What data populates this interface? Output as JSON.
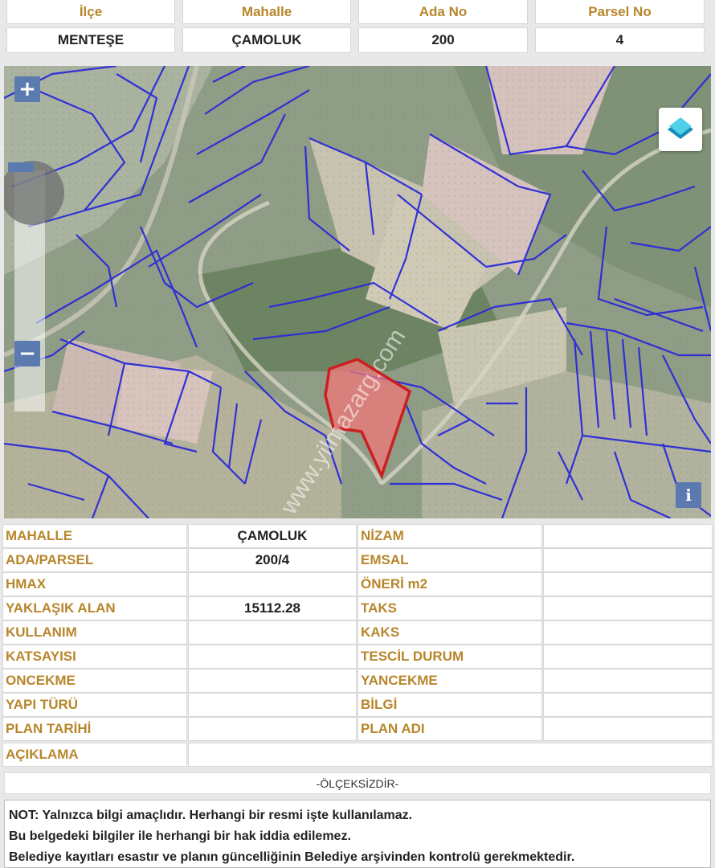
{
  "header": {
    "labels": [
      "İlçe",
      "Mahalle",
      "Ada No",
      "Parsel No"
    ],
    "values": [
      "MENTEŞE",
      "ÇAMOLUK",
      "200",
      "4"
    ]
  },
  "map": {
    "zoom_in_label": "+",
    "zoom_out_label": "−",
    "info_label": "i",
    "watermark": "www.yilmazarg.com",
    "colors": {
      "parcel_lines": "#2a2ad8",
      "selected_parcel": "#cc1f1f",
      "zoom_button": "#5b7ab0"
    }
  },
  "table": {
    "rows": [
      {
        "k1": "MAHALLE",
        "v1": "ÇAMOLUK",
        "k2": "NİZAM",
        "v2": ""
      },
      {
        "k1": "ADA/PARSEL",
        "v1": "200/4",
        "k2": "EMSAL",
        "v2": ""
      },
      {
        "k1": "HMAX",
        "v1": "",
        "k2": "ÖNERİ m2",
        "v2": ""
      },
      {
        "k1": "YAKLAŞIK ALAN",
        "v1": "15112.28",
        "k2": "TAKS",
        "v2": ""
      },
      {
        "k1": "KULLANIM",
        "v1": "",
        "k2": "KAKS",
        "v2": ""
      },
      {
        "k1": "KATSAYISI",
        "v1": "",
        "k2": "TESCİL DURUM",
        "v2": ""
      },
      {
        "k1": "ONCEKME",
        "v1": "",
        "k2": "YANCEKME",
        "v2": ""
      },
      {
        "k1": "YAPI TÜRÜ",
        "v1": "",
        "k2": "BİLGİ",
        "v2": ""
      },
      {
        "k1": "PLAN TARİHİ",
        "v1": "",
        "k2": "PLAN ADI",
        "v2": ""
      }
    ],
    "description_label": "AÇIKLAMA",
    "description_value": ""
  },
  "scale_text": "-ÖLÇEKSİZDİR-",
  "note": [
    "NOT: Yalnızca bilgi amaçlıdır. Herhangi bir resmi işte kullanılamaz.",
    "Bu belgedeki bilgiler ile herhangi bir hak iddia edilemez.",
    "Belediye kayıtları esastır ve planın güncelliğinin Belediye arşivinden kontrolü gerekmektedir."
  ]
}
